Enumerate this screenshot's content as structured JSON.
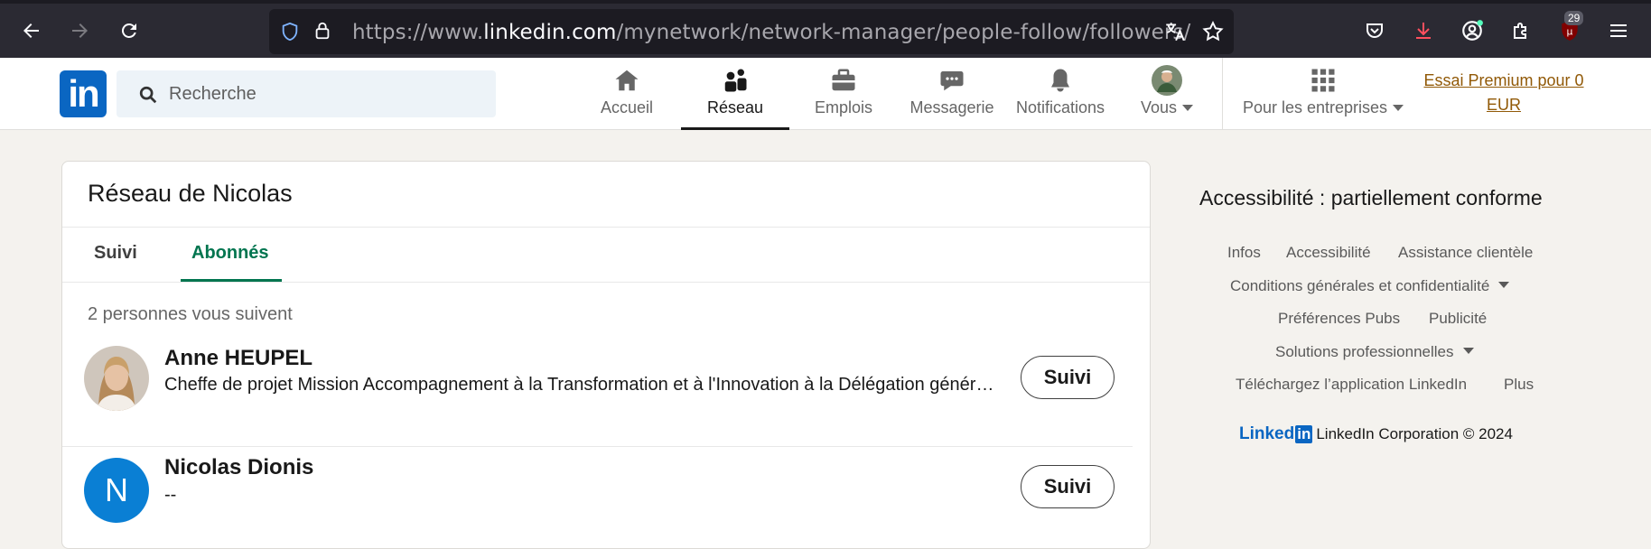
{
  "browser": {
    "url_prefix": "https://www.",
    "url_host": "linkedin.com",
    "url_path": "/mynetwork/network-manager/people-follow/followers/",
    "extension_badge": "29"
  },
  "header": {
    "logo": "in",
    "search_placeholder": "Recherche",
    "nav": {
      "home": "Accueil",
      "network": "Réseau",
      "jobs": "Emplois",
      "messaging": "Messagerie",
      "notifications": "Notifications",
      "me": "Vous",
      "business": "Pour les entreprises"
    },
    "premium_line1": "Essai Premium pour 0",
    "premium_line2": "EUR"
  },
  "main": {
    "title": "Réseau de Nicolas",
    "tabs": [
      {
        "label": "Suivi"
      },
      {
        "label": "Abonnés"
      }
    ],
    "count_text": "2 personnes vous suivent",
    "people": [
      {
        "name": "Anne HEUPEL",
        "headline": "Cheffe de projet Mission Accompagnement à la Transformation et à l'Innovation à la Délégation générale à l'emploi",
        "button": "Suivi"
      },
      {
        "name": "Nicolas Dionis",
        "initial": "N",
        "headline": "--",
        "button": "Suivi"
      }
    ]
  },
  "footer": {
    "title": "Accessibilité : partiellement conforme",
    "links": {
      "infos": "Infos",
      "accessibility": "Accessibilité",
      "support": "Assistance clientèle",
      "terms": "Conditions générales et confidentialité",
      "ad_prefs": "Préférences Pubs",
      "advertising": "Publicité",
      "business_solutions": "Solutions professionnelles",
      "download_app": "Téléchargez l’application LinkedIn",
      "more": "Plus"
    },
    "brand_word": "Linked",
    "brand_in": "in",
    "copyright": "LinkedIn Corporation © 2024"
  },
  "colors": {
    "linkedin_blue": "#0a66c2",
    "active_tab_green": "#01754f",
    "premium_gold": "#915907"
  }
}
